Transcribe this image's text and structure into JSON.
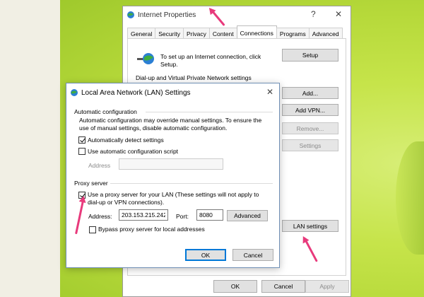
{
  "internet_properties": {
    "title": "Internet Properties",
    "help_glyph": "?",
    "close_glyph": "✕",
    "tabs": [
      {
        "label": "General"
      },
      {
        "label": "Security"
      },
      {
        "label": "Privacy"
      },
      {
        "label": "Content"
      },
      {
        "label": "Connections"
      },
      {
        "label": "Programs"
      },
      {
        "label": "Advanced"
      }
    ],
    "active_tab": "Connections",
    "setup_text": "To set up an Internet connection, click Setup.",
    "setup_button": "Setup",
    "dialup_label": "Dial-up and Virtual Private Network settings",
    "add_button": "Add...",
    "add_vpn_button": "Add VPN...",
    "remove_button": "Remove...",
    "settings_button": "Settings",
    "lan_settings_button": "LAN settings",
    "ok_button": "OK",
    "cancel_button": "Cancel",
    "apply_button": "Apply"
  },
  "lan_dialog": {
    "title": "Local Area Network (LAN) Settings",
    "close_glyph": "✕",
    "auto_config_label": "Automatic configuration",
    "auto_config_desc": "Automatic configuration may override manual settings.  To ensure the use of manual settings, disable automatic configuration.",
    "auto_detect_label": "Automatically detect settings",
    "auto_detect_checked": true,
    "auto_script_label": "Use automatic configuration script",
    "auto_script_checked": false,
    "script_address_label": "Address",
    "script_address_value": "",
    "proxy_label": "Proxy server",
    "use_proxy_label": "Use a proxy server for your LAN (These settings will not apply to dial-up or VPN connections).",
    "use_proxy_checked": true,
    "address_label": "Address:",
    "address_value": "203.153.215.242",
    "port_label": "Port:",
    "port_value": "8080",
    "advanced_button": "Advanced",
    "bypass_label": "Bypass proxy server for local addresses",
    "bypass_checked": false,
    "ok_button": "OK",
    "cancel_button": "Cancel"
  },
  "colors": {
    "arrow": "#e83a7c",
    "accent": "#0078d7",
    "desktop": "#c6e44a"
  }
}
